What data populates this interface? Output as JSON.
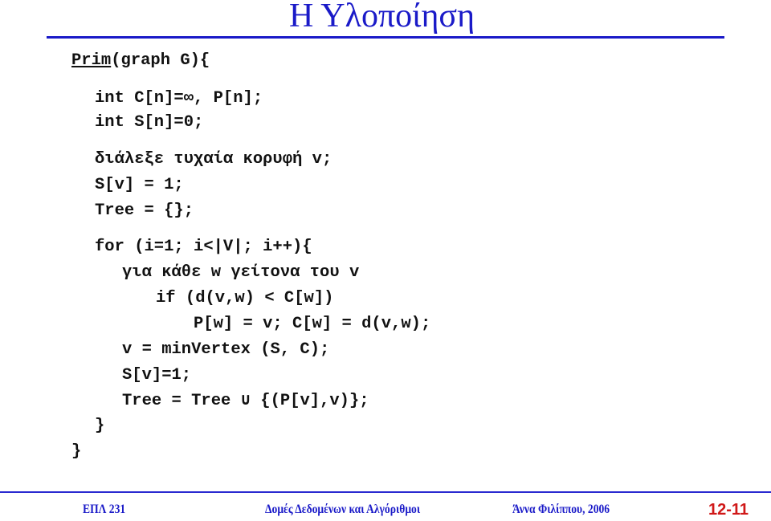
{
  "slide": {
    "title": "Η Υλοποίηση",
    "colors": {
      "title": "#1a1ac8",
      "rule": "#1a1ac8",
      "code": "#111111",
      "footer": "#1a1ac8",
      "page_number": "#d01818"
    }
  },
  "code": {
    "signature_name": "Prim",
    "signature_rest": "(graph G){",
    "lines": [
      "int C[n]=∞, P[n];",
      "int S[n]=0;",
      "διάλεξε τυχαία κορυφή v;",
      "S[v] = 1;",
      "Tree = {};",
      "for (i=1; i<|V|; i++){",
      "για κάθε w γείτονα του v",
      "if (d(v,w) < C[w])",
      "P[w] = v; C[w] = d(v,w);",
      "v = minVertex (S, C);",
      "S[v]=1;",
      "Tree = Tree ∪ {(P[v],v)};",
      "}",
      "}"
    ]
  },
  "footer": {
    "course": "ΕΠΛ 231",
    "subject": "Δομές Δεδομένων και Αλγόριθμοι",
    "author": "Άννα Φιλίππου, 2006",
    "page_number": "12-11"
  }
}
